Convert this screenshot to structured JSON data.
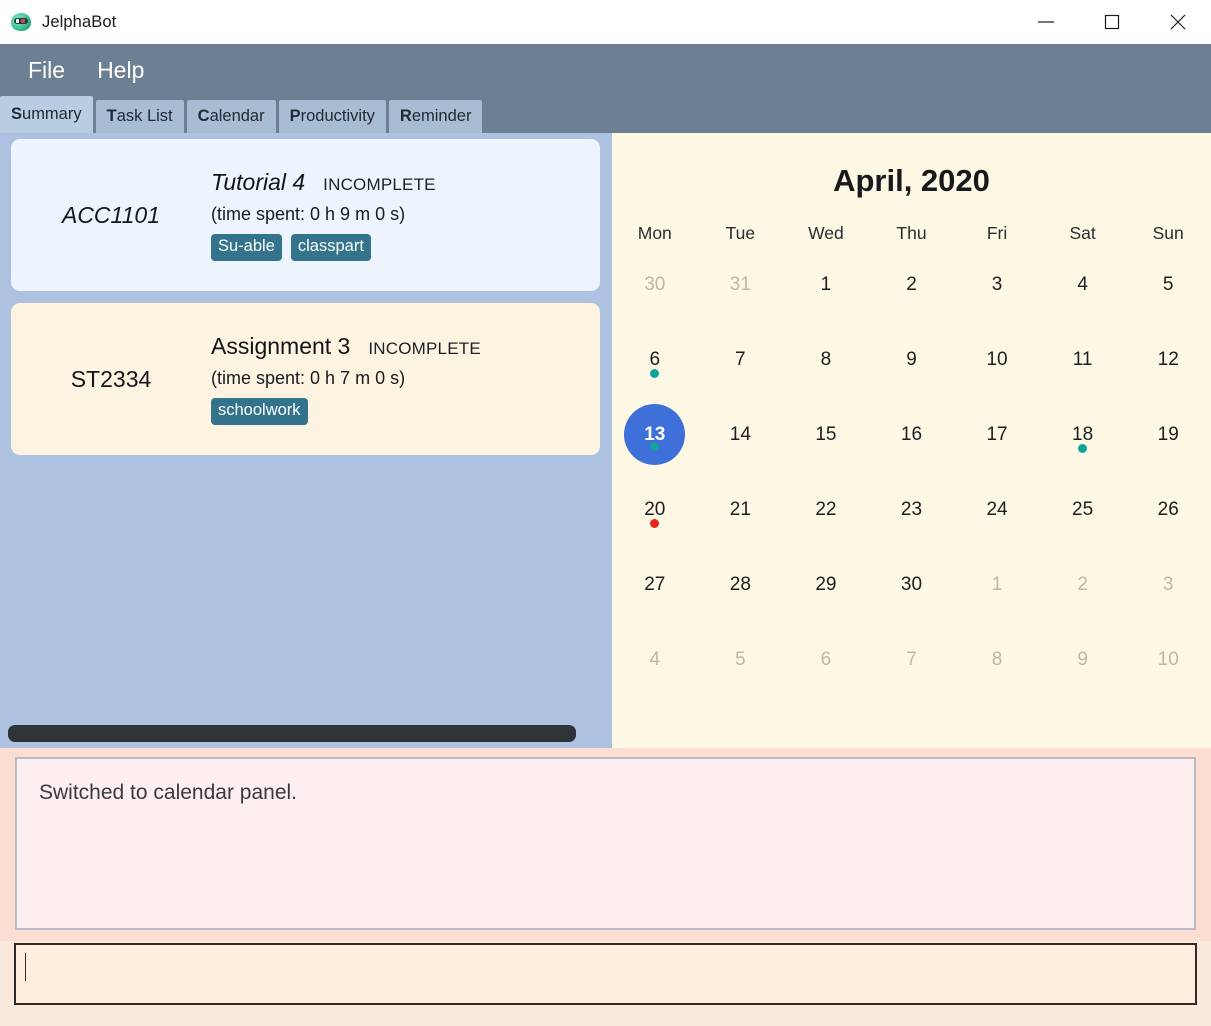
{
  "window": {
    "title": "JelphaBot",
    "icon": "robot-icon",
    "controls": {
      "minimize": "minimize-icon",
      "maximize": "maximize-icon",
      "close": "close-icon"
    }
  },
  "menubar": {
    "items": [
      {
        "label": "File"
      },
      {
        "label": "Help"
      }
    ]
  },
  "tabs": [
    {
      "mnemonic": "S",
      "rest": "ummary",
      "label": "Summary",
      "selected": true
    },
    {
      "mnemonic": "T",
      "rest": "ask List",
      "label": "Task List",
      "selected": false
    },
    {
      "mnemonic": "C",
      "rest": "alendar",
      "label": "Calendar",
      "selected": false
    },
    {
      "mnemonic": "P",
      "rest": "roductivity",
      "label": "Productivity",
      "selected": false
    },
    {
      "mnemonic": "R",
      "rest": "eminder",
      "label": "Reminder",
      "selected": false
    }
  ],
  "task_list": {
    "cards": [
      {
        "module": "ACC1101",
        "title": "Tutorial 4",
        "status": "INCOMPLETE",
        "time_spent": "(time spent: 0 h 9 m 0 s)",
        "tags": [
          "Su-able",
          "classpart"
        ],
        "background": "#edf4fd",
        "italic": true
      },
      {
        "module": "ST2334",
        "title": "Assignment 3",
        "status": "INCOMPLETE",
        "time_spent": "(time spent: 0 h 7 m 0 s)",
        "tags": [
          "schoolwork"
        ],
        "background": "#fdf3e1",
        "italic": false
      }
    ],
    "scrollbar": {
      "name": "horizontal-scrollbar",
      "thumb_fraction": 0.95
    }
  },
  "calendar": {
    "title": "April, 2020",
    "weekdays": [
      "Mon",
      "Tue",
      "Wed",
      "Thu",
      "Fri",
      "Sat",
      "Sun"
    ],
    "selected_day": 13,
    "accent_selected": "#3f6fd8",
    "dot_colors": {
      "teal": "#0fa39b",
      "red": "#e8241d"
    },
    "weeks": [
      [
        {
          "n": "30",
          "muted": true
        },
        {
          "n": "31",
          "muted": true
        },
        {
          "n": "1",
          "muted": false
        },
        {
          "n": "2",
          "muted": false
        },
        {
          "n": "3",
          "muted": false
        },
        {
          "n": "4",
          "muted": false
        },
        {
          "n": "5",
          "muted": false
        }
      ],
      [
        {
          "n": "6",
          "muted": false,
          "dot": "teal"
        },
        {
          "n": "7",
          "muted": false
        },
        {
          "n": "8",
          "muted": false
        },
        {
          "n": "9",
          "muted": false
        },
        {
          "n": "10",
          "muted": false
        },
        {
          "n": "11",
          "muted": false
        },
        {
          "n": "12",
          "muted": false
        }
      ],
      [
        {
          "n": "13",
          "muted": false,
          "dot": "teal",
          "selected": true
        },
        {
          "n": "14",
          "muted": false
        },
        {
          "n": "15",
          "muted": false
        },
        {
          "n": "16",
          "muted": false
        },
        {
          "n": "17",
          "muted": false
        },
        {
          "n": "18",
          "muted": false,
          "dot": "teal"
        },
        {
          "n": "19",
          "muted": false
        }
      ],
      [
        {
          "n": "20",
          "muted": false,
          "dot": "red"
        },
        {
          "n": "21",
          "muted": false
        },
        {
          "n": "22",
          "muted": false
        },
        {
          "n": "23",
          "muted": false
        },
        {
          "n": "24",
          "muted": false
        },
        {
          "n": "25",
          "muted": false
        },
        {
          "n": "26",
          "muted": false
        }
      ],
      [
        {
          "n": "27",
          "muted": false
        },
        {
          "n": "28",
          "muted": false
        },
        {
          "n": "29",
          "muted": false
        },
        {
          "n": "30",
          "muted": false
        },
        {
          "n": "1",
          "muted": true
        },
        {
          "n": "2",
          "muted": true
        },
        {
          "n": "3",
          "muted": true
        }
      ],
      [
        {
          "n": "4",
          "muted": true
        },
        {
          "n": "5",
          "muted": true
        },
        {
          "n": "6",
          "muted": true
        },
        {
          "n": "7",
          "muted": true
        },
        {
          "n": "8",
          "muted": true
        },
        {
          "n": "9",
          "muted": true
        },
        {
          "n": "10",
          "muted": true
        }
      ]
    ]
  },
  "result_display": {
    "message": "Switched to calendar panel."
  },
  "command_input": {
    "value": "",
    "placeholder": ""
  }
}
